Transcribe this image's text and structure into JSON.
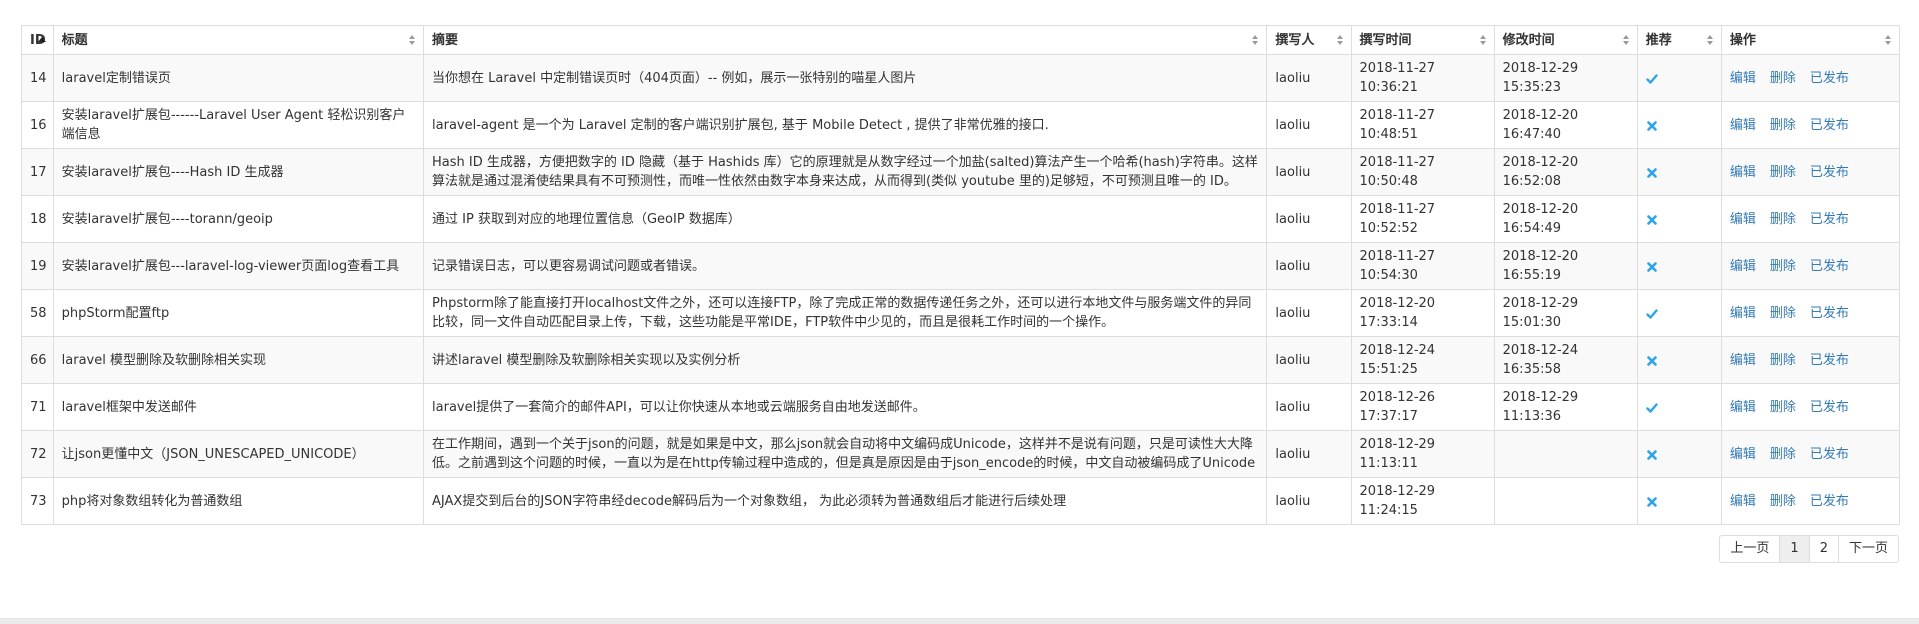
{
  "table": {
    "headers": [
      "ID",
      "标题",
      "摘要",
      "撰写人",
      "撰写时间",
      "修改时间",
      "推荐",
      "操作"
    ],
    "rows": [
      {
        "id": "14",
        "title": "laravel定制错误页",
        "summary": "当你想在 Laravel 中定制错误页时（404页面）-- 例如，展示一张特别的喵星人图片",
        "author": "laoliu",
        "created": "2018-11-27 10:36:21",
        "modified": "2018-12-29 15:35:23",
        "recommended": true
      },
      {
        "id": "16",
        "title": "安装laravel扩展包------Laravel User Agent 轻松识别客户端信息",
        "summary": "laravel-agent 是一个为 Laravel 定制的客户端识别扩展包, 基于 Mobile Detect , 提供了非常优雅的接口.",
        "author": "laoliu",
        "created": "2018-11-27 10:48:51",
        "modified": "2018-12-20 16:47:40",
        "recommended": false
      },
      {
        "id": "17",
        "title": "安装laravel扩展包----Hash ID 生成器",
        "summary": "Hash ID 生成器，方便把数字的 ID 隐藏（基于 Hashids 库）它的原理就是从数字经过一个加盐(salted)算法产生一个哈希(hash)字符串。这样算法就是通过混淆使结果具有不可预测性，而唯一性依然由数字本身来达成，从而得到(类似 youtube 里的)足够短，不可预测且唯一的 ID。",
        "author": "laoliu",
        "created": "2018-11-27 10:50:48",
        "modified": "2018-12-20 16:52:08",
        "recommended": false
      },
      {
        "id": "18",
        "title": "安装laravel扩展包----torann/geoip",
        "summary": "通过 IP 获取到对应的地理位置信息（GeoIP 数据库）",
        "author": "laoliu",
        "created": "2018-11-27 10:52:52",
        "modified": "2018-12-20 16:54:49",
        "recommended": false
      },
      {
        "id": "19",
        "title": "安装laravel扩展包---laravel-log-viewer页面log查看工具",
        "summary": "记录错误日志，可以更容易调试问题或者错误。",
        "author": "laoliu",
        "created": "2018-11-27 10:54:30",
        "modified": "2018-12-20 16:55:19",
        "recommended": false
      },
      {
        "id": "58",
        "title": "phpStorm配置ftp",
        "summary": "Phpstorm除了能直接打开localhost文件之外，还可以连接FTP，除了完成正常的数据传递任务之外，还可以进行本地文件与服务端文件的异同比较，同一文件自动匹配目录上传，下载，这些功能是平常IDE，FTP软件中少见的，而且是很耗工作时间的一个操作。",
        "author": "laoliu",
        "created": "2018-12-20 17:33:14",
        "modified": "2018-12-29 15:01:30",
        "recommended": true
      },
      {
        "id": "66",
        "title": "laravel 模型删除及软删除相关实现",
        "summary": "讲述laravel 模型删除及软删除相关实现以及实例分析",
        "author": "laoliu",
        "created": "2018-12-24 15:51:25",
        "modified": "2018-12-24 16:35:58",
        "recommended": false
      },
      {
        "id": "71",
        "title": "laravel框架中发送邮件",
        "summary": "laravel提供了一套简介的邮件API，可以让你快速从本地或云端服务自由地发送邮件。",
        "author": "laoliu",
        "created": "2018-12-26 17:37:17",
        "modified": "2018-12-29 11:13:36",
        "recommended": true
      },
      {
        "id": "72",
        "title": "让json更懂中文（JSON_UNESCAPED_UNICODE）",
        "summary": "在工作期间，遇到一个关于json的问题，就是如果是中文，那么json就会自动将中文编码成Unicode，这样并不是说有问题，只是可读性大大降低。之前遇到这个问题的时候，一直以为是在http传输过程中造成的，但是真是原因是由于json_encode的时候，中文自动被编码成了Unicode",
        "author": "laoliu",
        "created": "2018-12-29 11:13:11",
        "modified": "",
        "recommended": false
      },
      {
        "id": "73",
        "title": "php将对象数组转化为普通数组",
        "summary": "AJAX提交到后台的JSON字符串经decode解码后为一个对象数组， 为此必须转为普通数组后才能进行后续处理",
        "author": "laoliu",
        "created": "2018-12-29 11:24:15",
        "modified": "",
        "recommended": false
      }
    ],
    "actions": {
      "edit": "编辑",
      "delete": "删除",
      "publish": "已发布"
    }
  },
  "pagination": {
    "prev": "上一页",
    "pages": [
      "1",
      "2"
    ],
    "current": "1",
    "next": "下一页"
  },
  "colors": {
    "link": "#337ab7",
    "check": "#2fa4e7",
    "cross": "#2fa4e7",
    "border": "#dddddd",
    "stripe": "#f9f9f9"
  },
  "icons": {
    "recommended": "check-icon",
    "not_recommended": "cross-icon",
    "sort": "sort-both-icon",
    "sort_active": "sort-asc-icon"
  }
}
